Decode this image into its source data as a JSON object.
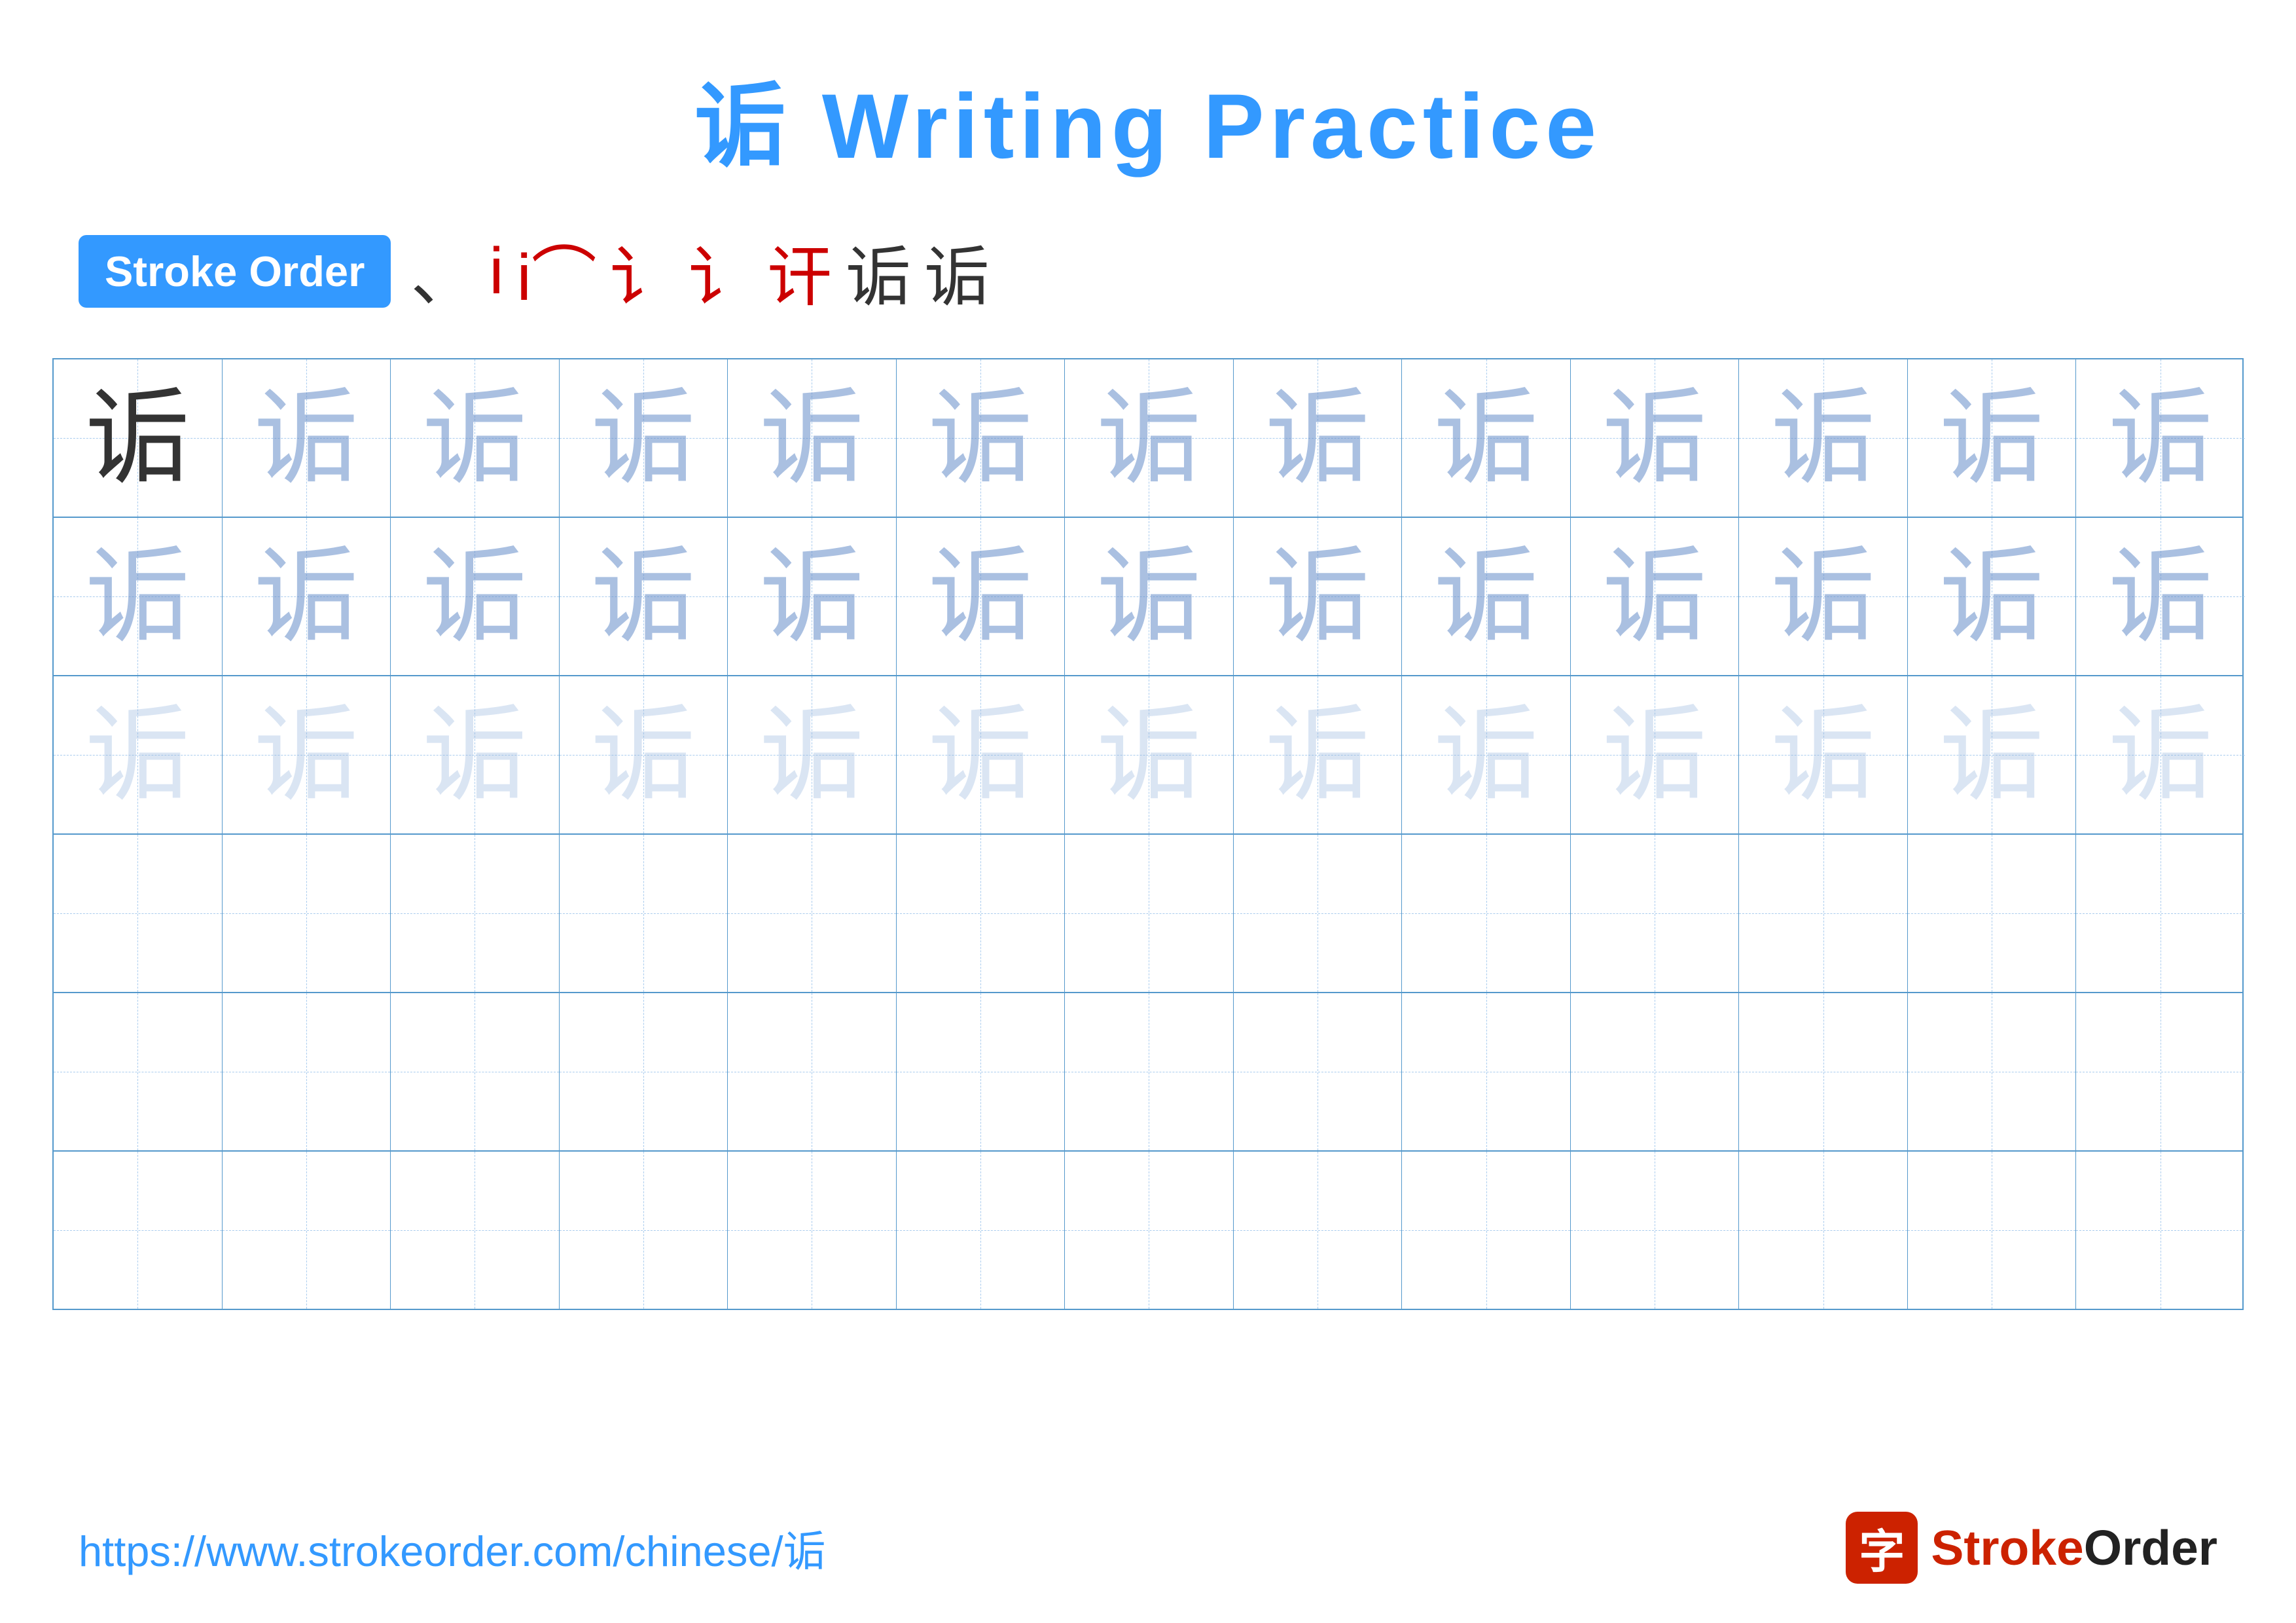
{
  "title": {
    "text": "诟 Writing Practice"
  },
  "stroke_order": {
    "badge_label": "Stroke Order",
    "strokes": [
      "、",
      "i",
      "i⌒",
      "讠",
      "讠",
      "讠",
      "诟",
      "诟"
    ]
  },
  "grid": {
    "rows": 6,
    "cols": 13,
    "character": "诟",
    "row_styles": [
      "solid",
      "faded-dark",
      "faded-light",
      "empty",
      "empty",
      "empty"
    ]
  },
  "footer": {
    "url": "https://www.strokeorder.com/chinese/诟",
    "logo_icon": "字",
    "logo_name": "StrokeOrder"
  }
}
